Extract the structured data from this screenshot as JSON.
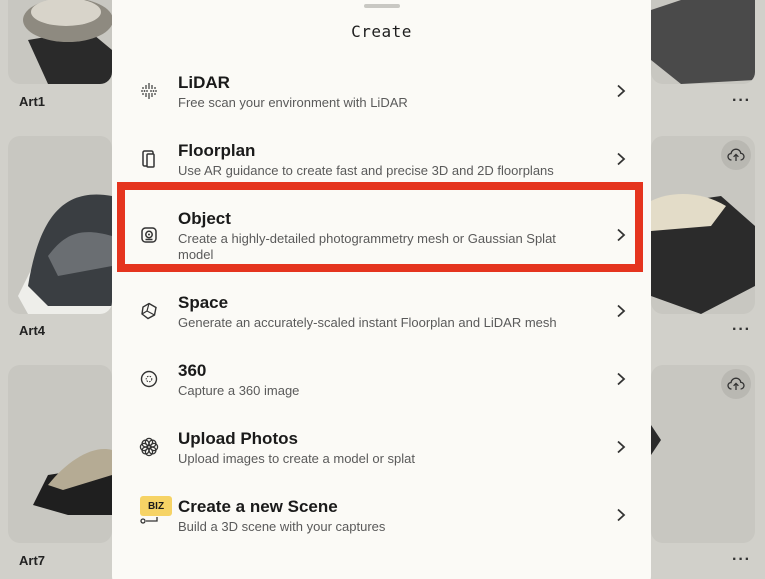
{
  "gallery": {
    "tiles": [
      {
        "name": "Art1",
        "more": "···"
      },
      {
        "name": "Art4",
        "more": "···"
      },
      {
        "name": "Art7",
        "more": "···"
      },
      {
        "more": "···"
      },
      {
        "more": "···"
      },
      {
        "more": "···"
      }
    ],
    "cloud_icon": "cloud-upload-icon"
  },
  "sheet": {
    "title": "Create",
    "items": [
      {
        "label": "LiDAR",
        "desc": "Free scan your environment with LiDAR",
        "icon": "lidar-icon"
      },
      {
        "label": "Floorplan",
        "desc": "Use AR guidance to create fast and precise 3D and 2D floorplans",
        "icon": "floorplan-icon"
      },
      {
        "label": "Object",
        "desc": "Create a highly-detailed photogrammetry mesh or Gaussian Splat model",
        "icon": "object-icon"
      },
      {
        "label": "Space",
        "desc": "Generate an accurately-scaled instant Floorplan and LiDAR mesh",
        "icon": "space-icon"
      },
      {
        "label": "360",
        "desc": "Capture a 360 image",
        "icon": "360-icon"
      },
      {
        "label": "Upload Photos",
        "desc": "Upload images to create a model or splat",
        "icon": "upload-photos-icon"
      },
      {
        "label": "Create a new Scene",
        "desc": "Build a 3D scene with your captures",
        "icon": "scene-icon",
        "badge": "BIZ"
      }
    ]
  },
  "colors": {
    "highlight": "#e5341e",
    "sheet_bg": "#fbfaf6",
    "badge": "#f6d365"
  }
}
